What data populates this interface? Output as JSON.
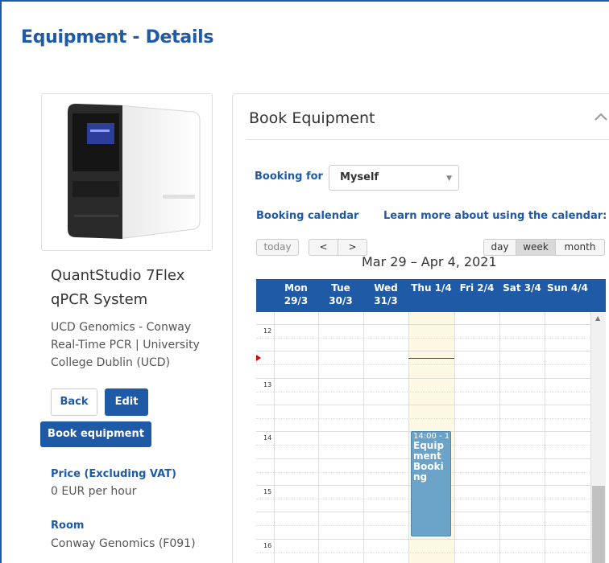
{
  "page": {
    "title": "Equipment - Details"
  },
  "equipment": {
    "name": "QuantStudio 7Flex qPCR System",
    "facility": "UCD Genomics - Conway Real-Time PCR | University College Dublin (UCD)",
    "price_label": "Price (Excluding VAT)",
    "price_value": "0 EUR per hour",
    "room_label": "Room",
    "room_value": "Conway Genomics (F091)"
  },
  "actions": {
    "back": "Back",
    "edit": "Edit",
    "book": "Book equipment"
  },
  "panel": {
    "title": "Book Equipment",
    "collapse_icon": "chevron-up-icon",
    "booking_for_label": "Booking for",
    "booking_for_value": "Myself",
    "calendar_label": "Booking calendar",
    "calendar_help": "Learn more about using the calendar:"
  },
  "calendar": {
    "today": "today",
    "prev": "<",
    "next": ">",
    "views": {
      "day": "day",
      "week": "week",
      "month": "month"
    },
    "active_view": "week",
    "range_title": "Mar 29 – Apr 4, 2021",
    "days": [
      {
        "name": "Mon",
        "date": "29/3"
      },
      {
        "name": "Tue",
        "date": "30/3"
      },
      {
        "name": "Wed",
        "date": "31/3"
      },
      {
        "name": "Thu 1/4",
        "date": ""
      },
      {
        "name": "Fri 2/4",
        "date": ""
      },
      {
        "name": "Sat 3/4",
        "date": ""
      },
      {
        "name": "Sun 4/4",
        "date": ""
      }
    ],
    "hours": [
      "12",
      "13",
      "14",
      "15",
      "16"
    ],
    "event": {
      "time": "14:00 - 1",
      "title": "Equipment Booking"
    }
  },
  "colors": {
    "accent": "#1f5aa6",
    "today_bg": "#fcf8e3",
    "event_bg": "#6aa2c8",
    "now_line": "#dd0000"
  }
}
